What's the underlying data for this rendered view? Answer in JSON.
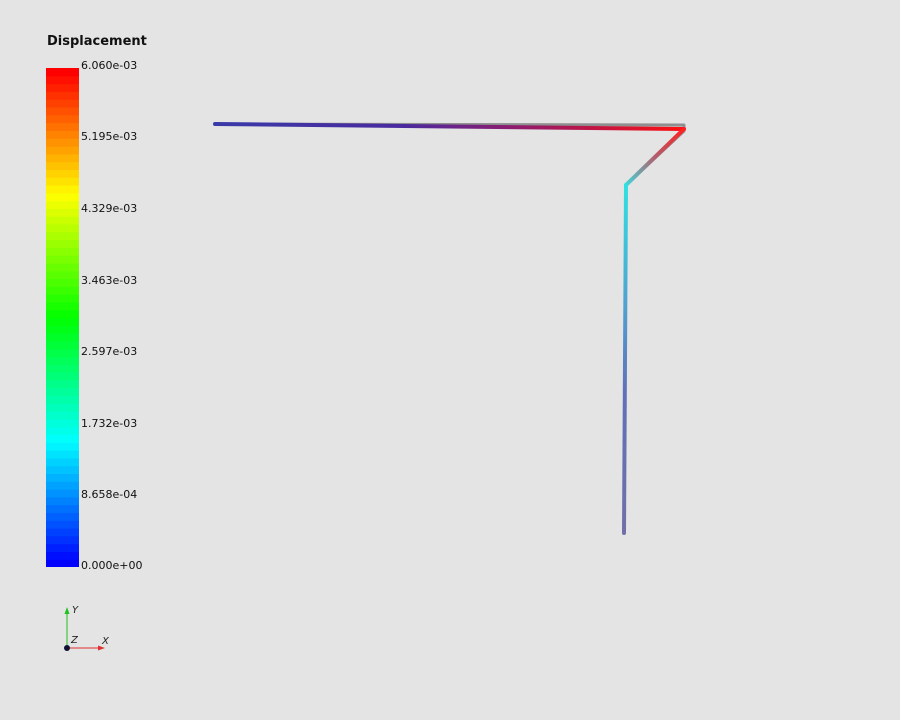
{
  "legend": {
    "title": "Displacement",
    "labels": [
      "6.060e-03",
      "5.195e-03",
      "4.329e-03",
      "3.463e-03",
      "2.597e-03",
      "1.732e-03",
      "8.658e-04",
      "0.000e+00"
    ],
    "range": [
      0,
      0.00606
    ],
    "colormap": [
      "#0000ff",
      "#00ffff",
      "#00ff00",
      "#ffff00",
      "#ff0000"
    ]
  },
  "axes": {
    "x_label": "X",
    "y_label": "Y",
    "z_label": "Z",
    "x_color": "#e03030",
    "y_color": "#20c020",
    "origin_color": "#111133"
  },
  "background": "#e4e4e4"
}
